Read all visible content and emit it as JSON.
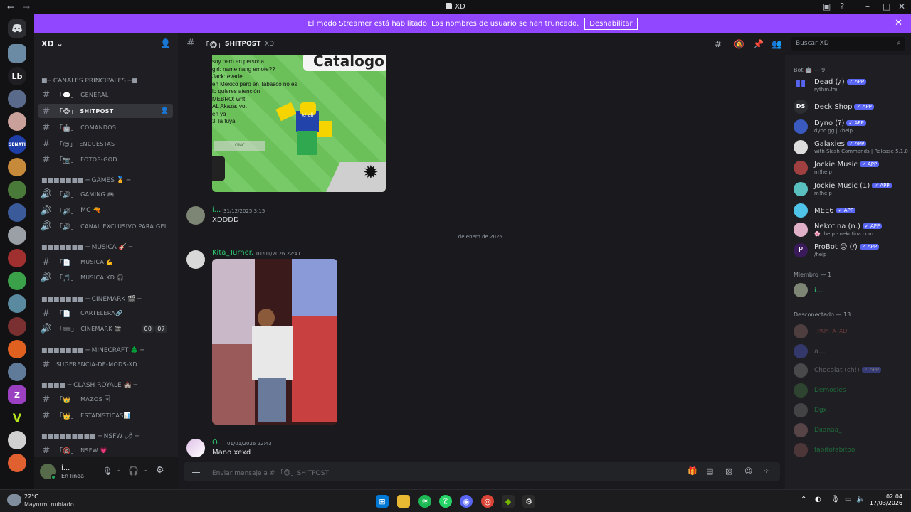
{
  "window": {
    "title": "XD"
  },
  "banner": {
    "text": "El modo Streamer está habilitado. Los nombres de usuario se han truncado.",
    "button": "Deshabilitar"
  },
  "server": {
    "name": "XD"
  },
  "categories": {
    "principales": "■─ CANALES PRINCIPALES ─■",
    "games": "■■■■■■■ ─ GAMES 🏅 ─",
    "musica": "■■■■■■■ ─ MUSICA 🎸 ─",
    "cinemark": "■■■■■■■ ─ CINEMARK 🎬 ─",
    "minecraft": "■■■■■■■ ─ MINECRAFT 🌲 ─",
    "clash": "■■■■ ─ CLASH ROYALE 🏰 ─",
    "nsfw": "■■■■■■■■■ ─ NSFW 🌶 ─"
  },
  "channels": {
    "general": "GENERAL",
    "shitpost": "SHITPOST",
    "comandos": "COMANDOS",
    "encuestas": "ENCUESTAS",
    "fotos": "FOTOS-GOD",
    "gaming": "GAMING 🎮",
    "mc": "MC 🔫",
    "canal_exclusivo": "CANAL EXCLUSIVO PARA GEI...",
    "musica": "MUSICA 💪",
    "musica_xd": "MUSICA XD 🎧",
    "cartelera": "CARTELERA🔗",
    "cinemark": "CINEMARK 🎬",
    "cinemark_badge_a": "00",
    "cinemark_badge_b": "07",
    "sugerencia": "SUGERENCIA-DE-MODS-XD",
    "mazos": "MAZOS 🃏",
    "estadisticas": "ESTADISTICAS📊",
    "nsfw": "NSFW 💗"
  },
  "user_panel": {
    "name": "i...",
    "status": "En línea"
  },
  "chat": {
    "channel": "SHITPOST",
    "server": "XD",
    "search_placeholder": "Buscar XD",
    "composer_placeholder": "Enviar mensaje a # 「🐵」SHITPOST"
  },
  "meme": {
    "lines": [
      "soy pero en persona",
      "girl: name nang emote??",
      "Jack: evade",
      "en Mexico pero en Tabasco no es",
      "lo quieres atención",
      "MEBRO: wht.",
      "AL Akaza: vot",
      "en ya",
      "3. la tuya"
    ],
    "catalog": "Catalogo",
    "char_label": "khali",
    "omc": "OMC"
  },
  "messages": [
    {
      "author": "i...",
      "time": "31/12/2025 3:15",
      "text": "XDDDD"
    },
    {
      "author": "Kita_Turner.",
      "time": "01/01/2026 22:41",
      "text": ""
    },
    {
      "author": "O...",
      "time": "01/01/2026 22:43",
      "text": "Mano xexd"
    }
  ],
  "date_divider": "1 de enero de 2026",
  "members": {
    "bot_header": "Bot 🤖 — 9",
    "member_header": "Miembro — 1",
    "offline_header": "Desconectado — 13",
    "app_badge": "✓ APP",
    "bots": [
      {
        "name": "Dead (¿)",
        "sub": "rythm.fm"
      },
      {
        "name": "Deck Shop",
        "sub": ""
      },
      {
        "name": "Dyno (?)",
        "sub": "dyno.gg | ?help"
      },
      {
        "name": "Galaxies",
        "sub": "with Slash Commands | Release 5.1.0"
      },
      {
        "name": "Jockie Music",
        "sub": "m!help"
      },
      {
        "name": "Jockie Music (1)",
        "sub": "m!help"
      },
      {
        "name": "MEE6",
        "sub": ""
      },
      {
        "name": "Nekotina (n.)",
        "sub": "🌸 !help · nekotina.com"
      },
      {
        "name": "ProBot 😊 (/)",
        "sub": "/help"
      }
    ],
    "online": [
      {
        "name": "i..."
      }
    ],
    "offline": [
      {
        "name": "_PAPITA_XD_"
      },
      {
        "name": "a..."
      },
      {
        "name": "Chocolat (ch!)"
      },
      {
        "name": "Democles"
      },
      {
        "name": "Dgx"
      },
      {
        "name": "Diianaa_"
      },
      {
        "name": "fabitofabitoo"
      }
    ]
  },
  "taskbar": {
    "weather_temp": "22°C",
    "weather_desc": "Mayorm. nublado",
    "time": "02:04",
    "date": "17/03/2026"
  },
  "colors": {
    "banner": "#9146ff",
    "online": "#23a55a",
    "app_badge": "#5865f2",
    "username_green": "#2dc770"
  }
}
